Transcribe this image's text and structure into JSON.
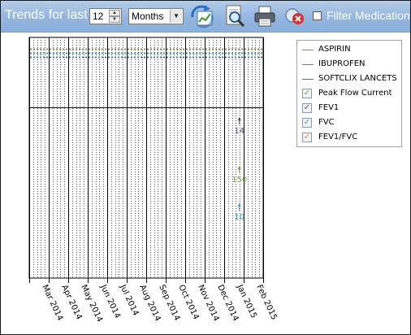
{
  "toolbar": {
    "trends_label": "Trends for last",
    "period_value": "12",
    "period_unit": "Months",
    "spin_up_glyph": "▲",
    "spin_down_glyph": "▼",
    "select_arrow_glyph": "▼",
    "filter_label": "Filter Medications",
    "icons": [
      "refresh-chart-icon",
      "zoom-icon",
      "print-icon",
      "remove-icon"
    ]
  },
  "legend": {
    "items": [
      {
        "label": "ASPIRIN",
        "kind": "line",
        "color": "#a08a3c"
      },
      {
        "label": "IBUPROFEN",
        "kind": "line",
        "color": "#4a8ab0"
      },
      {
        "label": "SOFTCLIX LANCETS",
        "kind": "line",
        "color": "#3a7f9f"
      },
      {
        "label": "Peak Flow Current",
        "kind": "check",
        "color": "#7aa832",
        "checked": true
      },
      {
        "label": "FEV1",
        "kind": "check",
        "color": "#5a4a8a",
        "checked": true
      },
      {
        "label": "FVC",
        "kind": "check",
        "color": "#2a9ac8",
        "checked": true
      },
      {
        "label": "FEV1/FVC",
        "kind": "check",
        "color": "#f08a24",
        "checked": true
      }
    ]
  },
  "chart_data": {
    "type": "line",
    "x_categories": [
      "Mar 2014",
      "Apr 2014",
      "May 2014",
      "Jun 2014",
      "Jul 2014",
      "Aug 2014",
      "Sep 2014",
      "Oct 2014",
      "Nov 2014",
      "Dec 2014",
      "Jan 2015",
      "Feb 2015"
    ],
    "medication_series": [
      {
        "name": "ASPIRIN",
        "color": "#a08a3c",
        "continuous": true
      },
      {
        "name": "IBUPROFEN",
        "color": "#4a8ab0",
        "continuous": true
      },
      {
        "name": "SOFTCLIX LANCETS",
        "color": "#3a7f9f",
        "continuous": true
      }
    ],
    "measurement_series": [
      {
        "name": "FEV1",
        "color": "#5a4a8a",
        "x": "Jan 2015",
        "value": 14
      },
      {
        "name": "Peak Flow Current",
        "color": "#7aa832",
        "x": "Jan 2015",
        "value": 150
      },
      {
        "name": "FVC",
        "color": "#2a9ac8",
        "x": "Jan 2015",
        "value": 10
      }
    ],
    "grid": true,
    "legend_position": "top-right"
  }
}
